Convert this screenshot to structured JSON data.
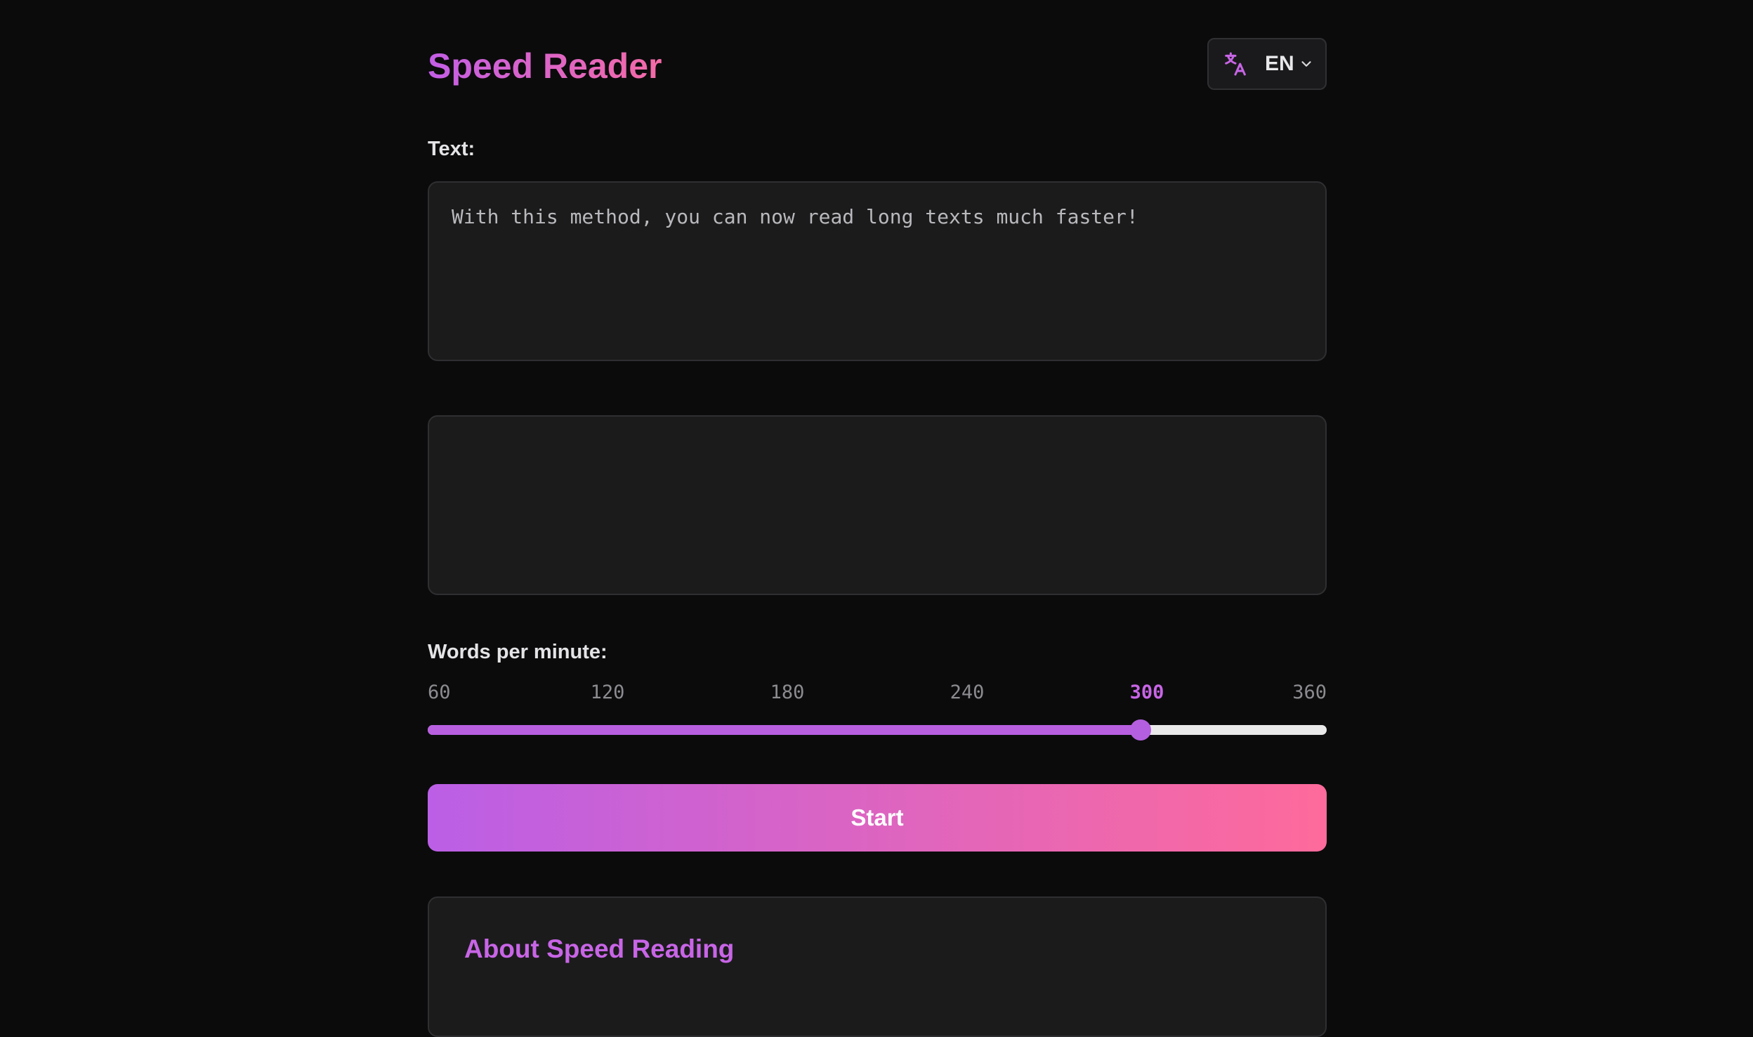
{
  "app": {
    "title": "Speed Reader"
  },
  "language": {
    "code": "EN",
    "icon": "translate-icon"
  },
  "text_section": {
    "label": "Text:",
    "value": "With this method, you can now read long texts much faster!"
  },
  "wpm": {
    "label": "Words per minute:",
    "ticks": [
      "60",
      "120",
      "180",
      "240",
      "300",
      "360"
    ],
    "min": 60,
    "max": 360,
    "value": 300
  },
  "actions": {
    "start_label": "Start"
  },
  "about": {
    "title": "About Speed Reading"
  },
  "colors": {
    "background": "#0b0b0c",
    "accent_purple": "#c35ee6",
    "accent_pink": "#fe6a9b",
    "panel": "#1b1b1c"
  }
}
